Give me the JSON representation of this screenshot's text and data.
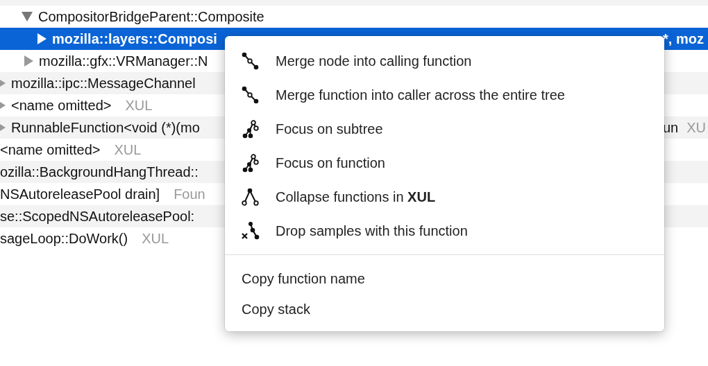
{
  "tree": [
    {
      "label": "CompositorBridgeParent::Composite",
      "expanded": true,
      "selected": false,
      "children": [
        {
          "label": "mozilla::layers::Composi",
          "tail": [
            "*, moz"
          ],
          "expanded": false,
          "selected": true
        }
      ]
    },
    {
      "label": "mozilla::gfx::VRManager::N",
      "expanded": false,
      "selected": false
    },
    {
      "label": "mozilla::ipc::MessageChannel",
      "expanded": false,
      "selected": false
    },
    {
      "label": "<name omitted>",
      "lib": "XUL",
      "expanded": false,
      "selected": false
    },
    {
      "label": "RunnableFunction<void (*)(mo",
      "tail": [
        "un",
        "XU"
      ],
      "expanded": false,
      "selected": false
    },
    {
      "label": "<name omitted>",
      "lib": "XUL",
      "selected": false
    },
    {
      "label": "ozilla::BackgroundHangThread::",
      "selected": false
    },
    {
      "label": "NSAutoreleasePool drain]",
      "lib": "Foun",
      "selected": false
    },
    {
      "label": "se::ScopedNSAutoreleasePool:",
      "selected": false
    },
    {
      "label": "sageLoop::DoWork()",
      "lib": "XUL",
      "selected": false
    }
  ],
  "context_menu": {
    "items": [
      {
        "label": "Merge node into calling function"
      },
      {
        "label": "Merge function into caller across the entire tree"
      },
      {
        "label": "Focus on subtree"
      },
      {
        "label": "Focus on function"
      },
      {
        "label": "Collapse functions in **XUL**"
      },
      {
        "label": "Drop samples with this function"
      }
    ],
    "copy_items": [
      "Copy function name",
      "Copy stack"
    ]
  }
}
